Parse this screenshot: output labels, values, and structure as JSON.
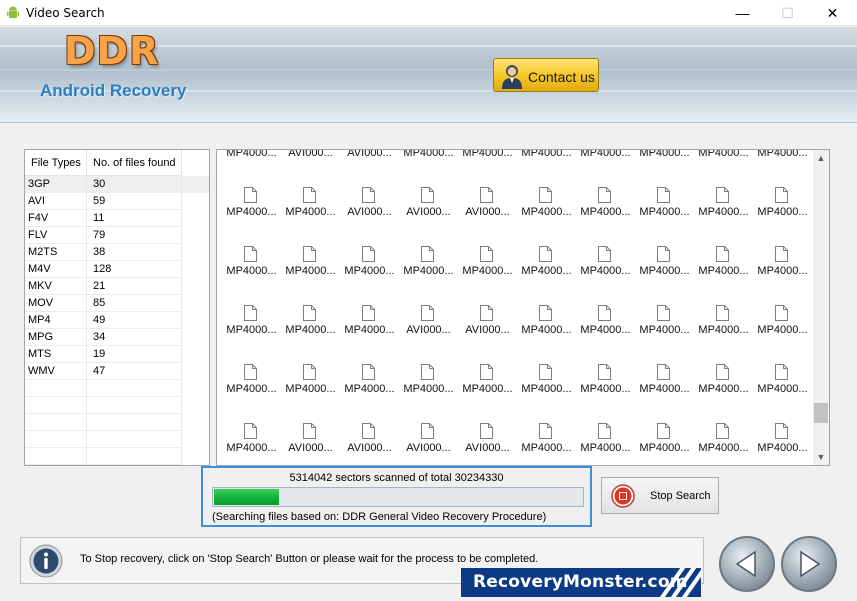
{
  "window": {
    "title": "Video Search",
    "controls": {
      "minimize": "—",
      "maximize": "☐",
      "close": "✕"
    }
  },
  "header": {
    "logo": "DDR",
    "product": "Android Recovery",
    "contact_label": "Contact us"
  },
  "file_types": {
    "columns": [
      "File Types",
      "No. of files found"
    ],
    "rows": [
      {
        "type": "3GP",
        "count": "30"
      },
      {
        "type": "AVI",
        "count": "59"
      },
      {
        "type": "F4V",
        "count": "11"
      },
      {
        "type": "FLV",
        "count": "79"
      },
      {
        "type": "M2TS",
        "count": "38"
      },
      {
        "type": "M4V",
        "count": "128"
      },
      {
        "type": "MKV",
        "count": "21"
      },
      {
        "type": "MOV",
        "count": "85"
      },
      {
        "type": "MP4",
        "count": "49"
      },
      {
        "type": "MPG",
        "count": "34"
      },
      {
        "type": "MTS",
        "count": "19"
      },
      {
        "type": "WMV",
        "count": "47"
      }
    ],
    "selected_index": 0
  },
  "files": {
    "rows": [
      [
        "MP4000...",
        "AVI000...",
        "AVI000...",
        "MP4000...",
        "MP4000...",
        "MP4000...",
        "MP4000...",
        "MP4000...",
        "MP4000...",
        "MP4000..."
      ],
      [
        "MP4000...",
        "MP4000...",
        "AVI000...",
        "AVI000...",
        "AVI000...",
        "MP4000...",
        "MP4000...",
        "MP4000...",
        "MP4000...",
        "MP4000..."
      ],
      [
        "MP4000...",
        "MP4000...",
        "MP4000...",
        "MP4000...",
        "MP4000...",
        "MP4000...",
        "MP4000...",
        "MP4000...",
        "MP4000...",
        "MP4000..."
      ],
      [
        "MP4000...",
        "MP4000...",
        "MP4000...",
        "AVI000...",
        "AVI000...",
        "MP4000...",
        "MP4000...",
        "MP4000...",
        "MP4000...",
        "MP4000..."
      ],
      [
        "MP4000...",
        "MP4000...",
        "MP4000...",
        "MP4000...",
        "MP4000...",
        "MP4000...",
        "MP4000...",
        "MP4000...",
        "MP4000...",
        "MP4000..."
      ],
      [
        "MP4000...",
        "AVI000...",
        "AVI000...",
        "AVI000...",
        "AVI000...",
        "MP4000...",
        "MP4000...",
        "MP4000...",
        "MP4000...",
        "MP4000..."
      ]
    ],
    "scroll_position": 0.9
  },
  "progress": {
    "status": "5314042 sectors scanned of total 30234330",
    "fraction": 0.176,
    "method": "(Searching files based on:  DDR General Video Recovery Procedure)"
  },
  "stop_button": {
    "label": "Stop Search"
  },
  "footer": {
    "message": "To Stop recovery, click on 'Stop Search' Button or please wait for the process to be completed.",
    "brand": "RecoveryMonster.com"
  },
  "colors": {
    "progress_fill": "#0fae35",
    "highlight_border": "#3f8fd8",
    "contact_button": "#f5c829",
    "logo_orange": "#f7a34a",
    "product_blue": "#2a7fc0",
    "brand_bg": "#0d3a86"
  },
  "icons": {
    "app": "android-icon",
    "contact": "person-icon",
    "file": "document-icon",
    "stop": "stop-icon",
    "info": "info-icon",
    "back": "back-arrow-icon",
    "next": "next-arrow-icon"
  }
}
